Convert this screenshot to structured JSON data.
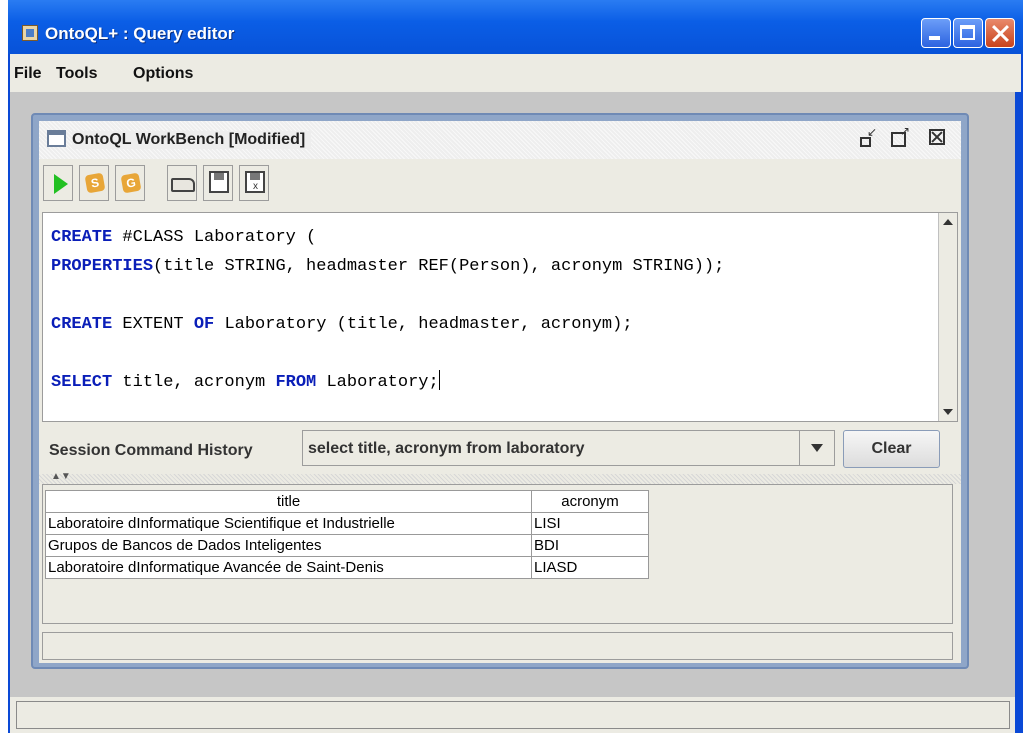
{
  "window": {
    "title": "OntoQL+ : Query editor"
  },
  "menu": {
    "file": "File",
    "tools": "Tools",
    "options": "Options"
  },
  "workbench": {
    "title": "OntoQL WorkBench [Modified]"
  },
  "toolbar": {
    "icons": [
      "run-icon",
      "s-coin-icon",
      "g-coin-icon",
      "open-folder-icon",
      "save-disk-icon",
      "save-as-disk-icon"
    ],
    "s_label": "S",
    "g_label": "G"
  },
  "editor": {
    "lines": [
      {
        "kw1": "CREATE",
        "t1": " #CLASS Laboratory ("
      },
      {
        "kw1": "PROPERTIES",
        "t1": "(title STRING, headmaster REF(Person), acronym STRING));"
      },
      {
        "kw1": "CREATE",
        "t1": " EXTENT ",
        "kw2": "OF",
        "t2": " Laboratory (title, headmaster, acronym);"
      },
      {
        "kw1": "SELECT",
        "t1": " title, acronym ",
        "kw2": "FROM",
        "t2": " Laboratory;"
      }
    ]
  },
  "history": {
    "label": "Session Command History",
    "selected": "select title, acronym from laboratory",
    "clear_label": "Clear"
  },
  "results": {
    "columns": [
      "title",
      "acronym"
    ],
    "rows": [
      [
        "Laboratoire dInformatique Scientifique et Industrielle",
        "LISI"
      ],
      [
        "Grupos de Bancos de Dados Inteligentes",
        "BDI"
      ],
      [
        "Laboratoire dInformatique Avancée de Saint-Denis",
        "LIASD"
      ]
    ]
  },
  "colors": {
    "titlebar": "#0b5ee6",
    "keyword": "#0a1eb8",
    "run_icon": "#22c022"
  }
}
